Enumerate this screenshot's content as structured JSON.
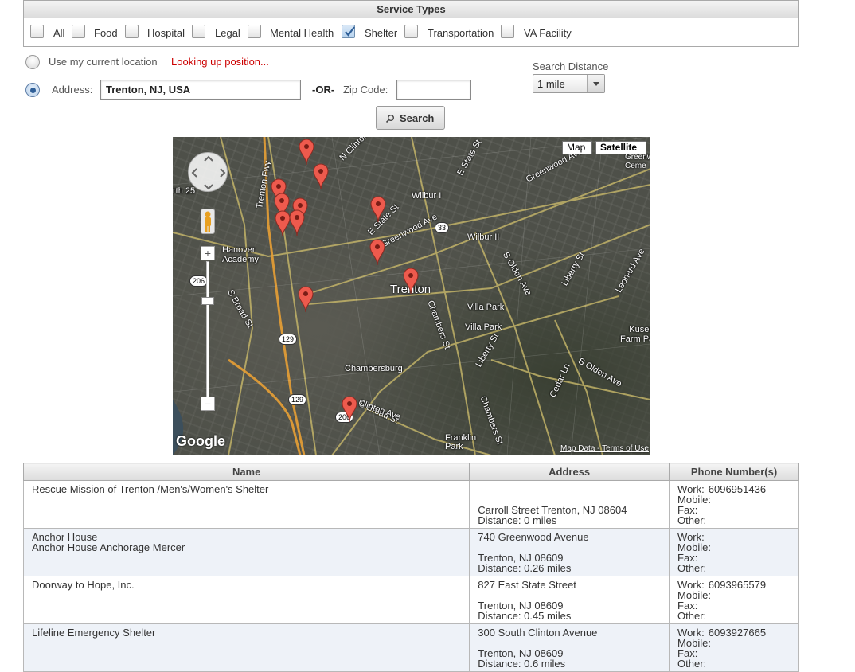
{
  "service_types": {
    "title": "Service Types",
    "options": [
      {
        "label": "All",
        "checked": false
      },
      {
        "label": "Food",
        "checked": false
      },
      {
        "label": "Hospital",
        "checked": false
      },
      {
        "label": "Legal",
        "checked": false
      },
      {
        "label": "Mental Health",
        "checked": false
      },
      {
        "label": "Shelter",
        "checked": true
      },
      {
        "label": "Transportation",
        "checked": false
      },
      {
        "label": "VA Facility",
        "checked": false
      }
    ]
  },
  "location": {
    "current_location_label": "Use my current location",
    "status_text": "Looking up position...",
    "address_label": "Address:",
    "address_value": "Trenton, NJ, USA",
    "or_label": "-OR-",
    "zip_label": "Zip Code:",
    "zip_value": "",
    "selected": "address"
  },
  "search_distance": {
    "label": "Search Distance",
    "value": "1 mile"
  },
  "search_button": {
    "label": "Search",
    "icon": "search-icon"
  },
  "map": {
    "map_button": "Map",
    "satellite_button": "Satellite",
    "active_type": "Satellite",
    "labels": {
      "trenton": "Trenton",
      "hanover_academy": "Hanover\nAcademy",
      "chambersburg": "Chambersburg",
      "villa_park_1": "Villa Park",
      "villa_park_2": "Villa Park",
      "kuser_farm": "Kuser\nFarm Park",
      "franklin_park": "Franklin\nPark",
      "wilbur_1": "Wilbur I",
      "wilbur_2": "Wilbur II",
      "greenwood_ave": "Greenwood Ave",
      "s_broad_st": "S Broad St",
      "e_state_st": "E State St",
      "clinton_ave": "Clinton Ave",
      "chambers_st": "Chambers St",
      "liberty_st": "Liberty St",
      "s_olden_ave": "S Olden Ave",
      "trenton_fwy": "Trenton Fwy",
      "n_clinton": "N Clinton",
      "leonard_ave": "Leonard Ave",
      "cedar_ln": "Cedar Ln",
      "route_25": "rth 25",
      "greenwood_cem": "Greenw\nCeme"
    },
    "shields": [
      "206",
      "129",
      "129",
      "33",
      "206"
    ],
    "logo": "Google",
    "attribution": "Map Data - Terms of Use"
  },
  "results": {
    "columns": [
      "Name",
      "Address",
      "Phone Number(s)"
    ],
    "phone_labels": {
      "work": "Work:",
      "mobile": "Mobile:",
      "fax": "Fax:",
      "other": "Other:"
    },
    "rows": [
      {
        "name_lines": [
          "Rescue Mission of Trenton /Men's/Women's Shelter"
        ],
        "address_lines": [
          "",
          "",
          "Carroll Street Trenton, NJ 08604",
          "Distance: 0 miles"
        ],
        "work": "6096951436",
        "mobile": "",
        "fax": "",
        "other": ""
      },
      {
        "name_lines": [
          "Anchor House",
          "Anchor House Anchorage Mercer"
        ],
        "address_lines": [
          "740 Greenwood Avenue",
          "",
          "Trenton, NJ 08609",
          "Distance: 0.26 miles"
        ],
        "work": "",
        "mobile": "",
        "fax": "",
        "other": ""
      },
      {
        "name_lines": [
          "Doorway to Hope, Inc."
        ],
        "address_lines": [
          "827 East State Street",
          "",
          "Trenton, NJ 08609",
          "Distance: 0.45 miles"
        ],
        "work": "6093965579",
        "mobile": "",
        "fax": "",
        "other": ""
      },
      {
        "name_lines": [
          "Lifeline Emergency Shelter"
        ],
        "address_lines": [
          "300 South Clinton Avenue",
          "",
          "Trenton, NJ 08609",
          "Distance: 0.6 miles"
        ],
        "work": "6093927665",
        "mobile": "",
        "fax": "",
        "other": ""
      }
    ]
  }
}
